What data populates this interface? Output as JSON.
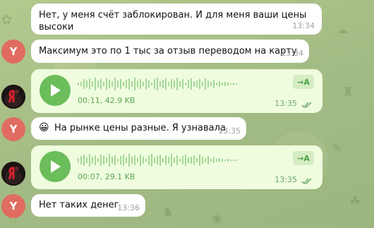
{
  "messages": [
    {
      "text": "Нет, у меня счёт заблокирован. И для меня ваши цены высоки",
      "time": "13:34"
    },
    {
      "text": "Максимум это по 1 тыс за отзыв переводом на карту",
      "time": "13:34",
      "avatar": "Y"
    },
    {
      "duration": "00:11, 42.9 KB",
      "time": "13:35",
      "transcribe": "→A"
    },
    {
      "emoji": "😀",
      "text": "На рынке цены разные. Я узнавала",
      "time": "13:35",
      "avatar": "Y"
    },
    {
      "duration": "00:07, 29.1 KB",
      "time": "13:35",
      "transcribe": "→A"
    },
    {
      "text": "Нет таких денег",
      "time": "13:36",
      "avatar": "Y"
    }
  ],
  "colors": {
    "accent": "#6cbd5b",
    "avatar": "#e06c61",
    "outgoing_bubble": "#effdde",
    "incoming_bubble": "#ffffff"
  },
  "icons": [
    "play-icon",
    "double-check-icon",
    "transcribe-icon",
    "avatar-photo-icon"
  ]
}
